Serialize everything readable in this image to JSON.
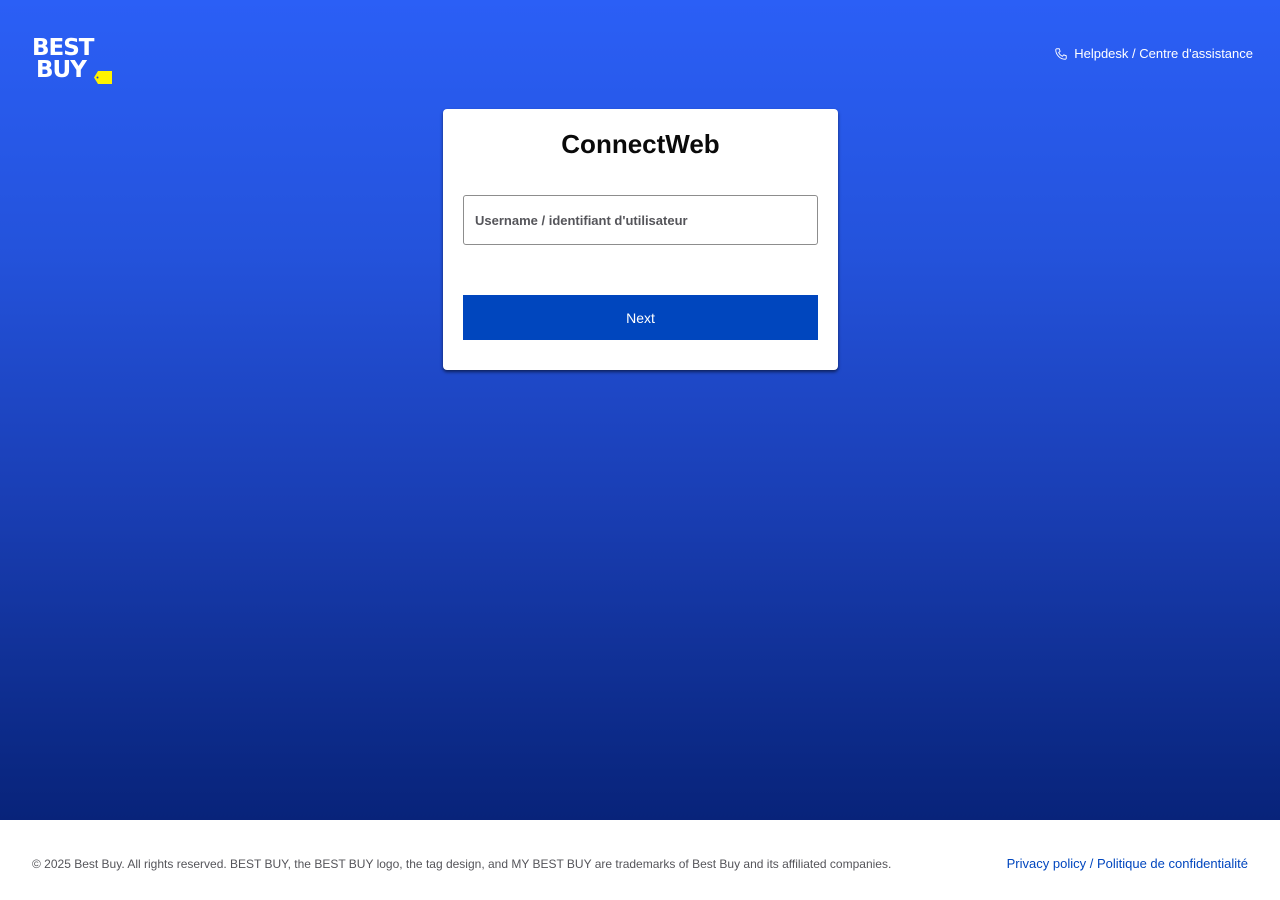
{
  "header": {
    "logo": {
      "line1": "BEST",
      "line2": "BUY",
      "tag_color": "#fff200"
    },
    "helpdesk": {
      "icon": "phone-icon",
      "label": "Helpdesk / Centre d'assistance"
    }
  },
  "login_card": {
    "title": "ConnectWeb",
    "username": {
      "placeholder": "Username / identifiant d'utilisateur",
      "value": ""
    },
    "next_label": "Next"
  },
  "footer": {
    "copyright": "© 2025 Best Buy. All rights reserved. BEST BUY, the BEST BUY logo, the tag design, and MY BEST BUY are trademarks of Best Buy and its affiliated companies.",
    "privacy_link": "Privacy policy / Politique de confidentialité"
  },
  "colors": {
    "brand_blue": "#0046be",
    "gradient_top": "#2b5ff6",
    "gradient_bottom": "#08237a",
    "tag_yellow": "#fff200"
  }
}
